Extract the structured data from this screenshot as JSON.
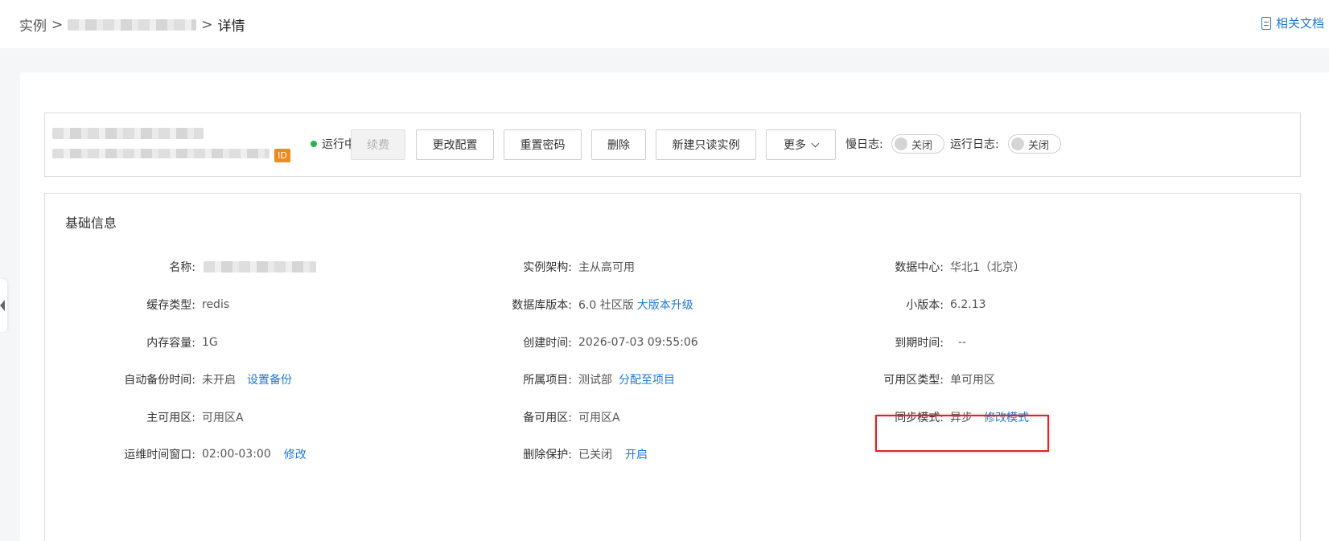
{
  "breadcrumb": {
    "root": "实例",
    "separator": ">",
    "current": "详情"
  },
  "header_link": {
    "docs_label": "相关文档",
    "icon": "document-icon"
  },
  "instance": {
    "id_badge": "ID",
    "status": "运行中",
    "status_color": "#2bb44a"
  },
  "actions": {
    "renew": "续费",
    "change_config": "更改配置",
    "reset_password": "重置密码",
    "delete": "删除",
    "new_readonly": "新建只读实例",
    "more": "更多"
  },
  "logs": {
    "slow_log_label": "慢日志:",
    "slow_log_state": "关闭",
    "run_log_label": "运行日志:",
    "run_log_state": "关闭"
  },
  "basic_info": {
    "title": "基础信息",
    "col1": [
      {
        "label": "名称:",
        "value": ""
      },
      {
        "label": "缓存类型:",
        "value": "redis"
      },
      {
        "label": "内存容量:",
        "value": "1G"
      },
      {
        "label": "自动备份时间:",
        "value": "未开启",
        "link": "设置备份"
      },
      {
        "label": "主可用区:",
        "value": "可用区A"
      },
      {
        "label": "运维时间窗口:",
        "value": "02:00-03:00",
        "link": "修改"
      }
    ],
    "col2": [
      {
        "label": "实例架构:",
        "value": "主从高可用"
      },
      {
        "label": "数据库版本:",
        "value": "6.0 社区版",
        "link": "大版本升级"
      },
      {
        "label": "创建时间:",
        "value": "2026-07-03 09:55:06"
      },
      {
        "label": "所属项目:",
        "value": "测试部",
        "link": "分配至项目"
      },
      {
        "label": "备可用区:",
        "value": "可用区A"
      },
      {
        "label": "删除保护:",
        "value": "已关闭",
        "link": "开启"
      }
    ],
    "col3": [
      {
        "label": "数据中心:",
        "value": "华北1（北京）"
      },
      {
        "label": "小版本:",
        "value": "6.2.13"
      },
      {
        "label": "到期时间:",
        "value": "--"
      },
      {
        "label": "可用区类型:",
        "value": "单可用区"
      },
      {
        "label": "同步模式:",
        "value": "异步",
        "link": "修改模式"
      }
    ]
  },
  "colors": {
    "link": "#1f78d1",
    "highlight": "#d9262a",
    "badge": "#f08a1c"
  }
}
